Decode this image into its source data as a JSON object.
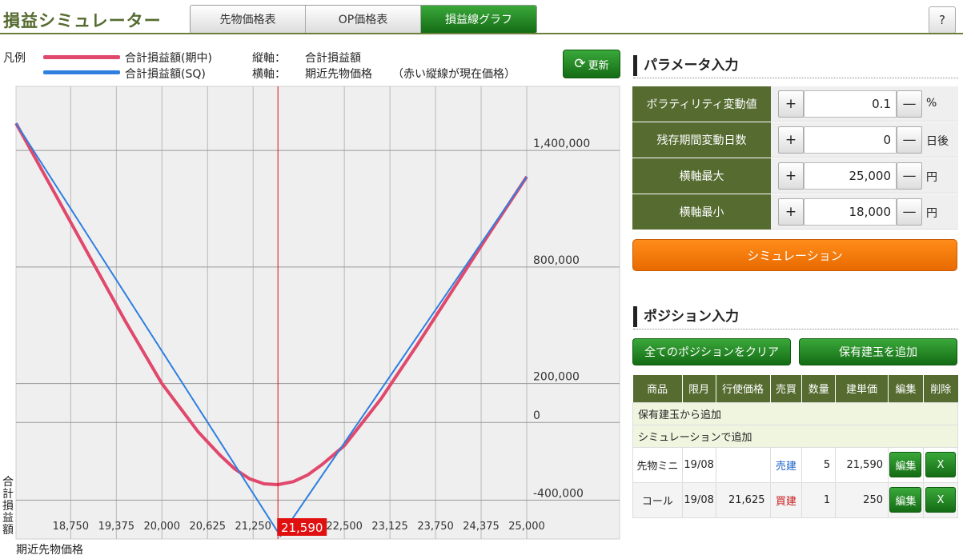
{
  "app": {
    "title": "損益シミュレーター",
    "help_label": "?"
  },
  "tabs": [
    {
      "label": "先物価格表",
      "active": false
    },
    {
      "label": "OP価格表",
      "active": false
    },
    {
      "label": "損益線グラフ",
      "active": true
    }
  ],
  "legend": {
    "label": "凡例",
    "items": [
      {
        "text": "合計損益額(期中)",
        "color": "#e0486c"
      },
      {
        "text": "合計損益額(SQ)",
        "color": "#2f7fe0"
      }
    ],
    "vertical_axis_label": "縦軸：",
    "vertical_axis_value": "合計損益額",
    "horizontal_axis_label": "横軸：",
    "horizontal_axis_value": "期近先物価格",
    "note": "（赤い縦線が現在価格）"
  },
  "refresh_label": "更新",
  "chart_data": {
    "type": "line",
    "ylabel": "合計損益額",
    "xlabel": "期近先物価格",
    "x_ticks": [
      18750,
      19375,
      20000,
      20625,
      21250,
      21590,
      22500,
      23125,
      23750,
      24375,
      25000
    ],
    "x_tick_labels": [
      "18,750",
      "19,375",
      "20,000",
      "20,625",
      "21,250",
      "21,590",
      "22,500",
      "23,125",
      "23,750",
      "24,375",
      "25,000"
    ],
    "y_ticks": [
      1400000,
      800000,
      200000,
      0,
      -400000
    ],
    "y_tick_labels": [
      "1,400,000",
      "800,000",
      "200,000",
      "0",
      "-400,000"
    ],
    "xlim": [
      18000,
      25000
    ],
    "ylim": [
      -600000,
      1730000
    ],
    "current_price": 21590,
    "current_price_label": "21,590",
    "series": [
      {
        "name": "合計損益額(期中)",
        "color": "#e0486c",
        "x": [
          18000,
          18500,
          19000,
          19500,
          20000,
          20500,
          20800,
          21000,
          21200,
          21400,
          21590,
          21800,
          22000,
          22200,
          22500,
          23000,
          23500,
          24000,
          24500,
          25000
        ],
        "y": [
          1540000,
          1200000,
          860000,
          520000,
          200000,
          -50000,
          -170000,
          -240000,
          -290000,
          -316000,
          -320000,
          -305000,
          -270000,
          -215000,
          -120000,
          120000,
          400000,
          690000,
          980000,
          1265000
        ]
      },
      {
        "name": "合計損益額(SQ)",
        "color": "#2f7fe0",
        "x": [
          18000,
          21625,
          25000
        ],
        "y": [
          1540000,
          -585000,
          1265000
        ]
      }
    ]
  },
  "params": {
    "title": "パラメータ入力",
    "rows": [
      {
        "label": "ボラティリティ変動値",
        "value": "0.1",
        "unit": "%"
      },
      {
        "label": "残存期間変動日数",
        "value": "0",
        "unit": "日後"
      },
      {
        "label": "横軸最大",
        "value": "25,000",
        "unit": "円"
      },
      {
        "label": "横軸最小",
        "value": "18,000",
        "unit": "円"
      }
    ],
    "plus": "+",
    "minus": "—",
    "simulate_label": "シミュレーション"
  },
  "positions": {
    "title": "ポジション入力",
    "clear_label": "全てのポジションをクリア",
    "add_label": "保有建玉を追加",
    "headers": [
      "商品",
      "限月",
      "行使価格",
      "売買",
      "数量",
      "建単価",
      "編集",
      "削除"
    ],
    "group_holding": "保有建玉から追加",
    "group_sim": "シミュレーションで追加",
    "edit_label": "編集",
    "delete_label": "X",
    "rows": [
      {
        "product": "先物ミニ",
        "month": "19/08",
        "strike": "",
        "side": "売建",
        "side_type": "sell",
        "qty": "5",
        "price": "21,590"
      },
      {
        "product": "コール",
        "month": "19/08",
        "strike": "21,625",
        "side": "買建",
        "side_type": "buy",
        "qty": "1",
        "price": "250"
      }
    ]
  }
}
